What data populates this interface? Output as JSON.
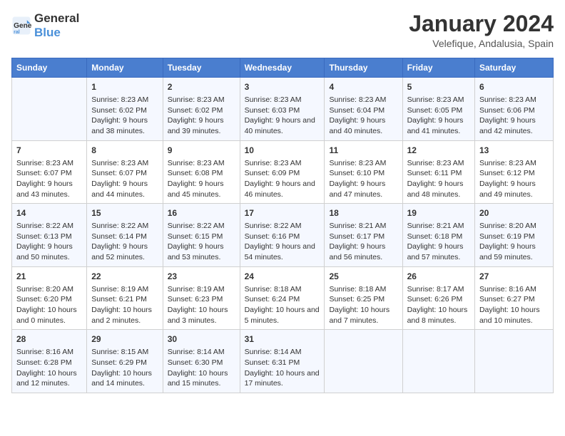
{
  "logo": {
    "text_general": "General",
    "text_blue": "Blue"
  },
  "title": "January 2024",
  "subtitle": "Velefique, Andalusia, Spain",
  "days_header": [
    "Sunday",
    "Monday",
    "Tuesday",
    "Wednesday",
    "Thursday",
    "Friday",
    "Saturday"
  ],
  "weeks": [
    [
      {
        "day": "",
        "sunrise": "",
        "sunset": "",
        "daylight": ""
      },
      {
        "day": "1",
        "sunrise": "Sunrise: 8:23 AM",
        "sunset": "Sunset: 6:02 PM",
        "daylight": "Daylight: 9 hours and 38 minutes."
      },
      {
        "day": "2",
        "sunrise": "Sunrise: 8:23 AM",
        "sunset": "Sunset: 6:02 PM",
        "daylight": "Daylight: 9 hours and 39 minutes."
      },
      {
        "day": "3",
        "sunrise": "Sunrise: 8:23 AM",
        "sunset": "Sunset: 6:03 PM",
        "daylight": "Daylight: 9 hours and 40 minutes."
      },
      {
        "day": "4",
        "sunrise": "Sunrise: 8:23 AM",
        "sunset": "Sunset: 6:04 PM",
        "daylight": "Daylight: 9 hours and 40 minutes."
      },
      {
        "day": "5",
        "sunrise": "Sunrise: 8:23 AM",
        "sunset": "Sunset: 6:05 PM",
        "daylight": "Daylight: 9 hours and 41 minutes."
      },
      {
        "day": "6",
        "sunrise": "Sunrise: 8:23 AM",
        "sunset": "Sunset: 6:06 PM",
        "daylight": "Daylight: 9 hours and 42 minutes."
      }
    ],
    [
      {
        "day": "7",
        "sunrise": "Sunrise: 8:23 AM",
        "sunset": "Sunset: 6:07 PM",
        "daylight": "Daylight: 9 hours and 43 minutes."
      },
      {
        "day": "8",
        "sunrise": "Sunrise: 8:23 AM",
        "sunset": "Sunset: 6:07 PM",
        "daylight": "Daylight: 9 hours and 44 minutes."
      },
      {
        "day": "9",
        "sunrise": "Sunrise: 8:23 AM",
        "sunset": "Sunset: 6:08 PM",
        "daylight": "Daylight: 9 hours and 45 minutes."
      },
      {
        "day": "10",
        "sunrise": "Sunrise: 8:23 AM",
        "sunset": "Sunset: 6:09 PM",
        "daylight": "Daylight: 9 hours and 46 minutes."
      },
      {
        "day": "11",
        "sunrise": "Sunrise: 8:23 AM",
        "sunset": "Sunset: 6:10 PM",
        "daylight": "Daylight: 9 hours and 47 minutes."
      },
      {
        "day": "12",
        "sunrise": "Sunrise: 8:23 AM",
        "sunset": "Sunset: 6:11 PM",
        "daylight": "Daylight: 9 hours and 48 minutes."
      },
      {
        "day": "13",
        "sunrise": "Sunrise: 8:23 AM",
        "sunset": "Sunset: 6:12 PM",
        "daylight": "Daylight: 9 hours and 49 minutes."
      }
    ],
    [
      {
        "day": "14",
        "sunrise": "Sunrise: 8:22 AM",
        "sunset": "Sunset: 6:13 PM",
        "daylight": "Daylight: 9 hours and 50 minutes."
      },
      {
        "day": "15",
        "sunrise": "Sunrise: 8:22 AM",
        "sunset": "Sunset: 6:14 PM",
        "daylight": "Daylight: 9 hours and 52 minutes."
      },
      {
        "day": "16",
        "sunrise": "Sunrise: 8:22 AM",
        "sunset": "Sunset: 6:15 PM",
        "daylight": "Daylight: 9 hours and 53 minutes."
      },
      {
        "day": "17",
        "sunrise": "Sunrise: 8:22 AM",
        "sunset": "Sunset: 6:16 PM",
        "daylight": "Daylight: 9 hours and 54 minutes."
      },
      {
        "day": "18",
        "sunrise": "Sunrise: 8:21 AM",
        "sunset": "Sunset: 6:17 PM",
        "daylight": "Daylight: 9 hours and 56 minutes."
      },
      {
        "day": "19",
        "sunrise": "Sunrise: 8:21 AM",
        "sunset": "Sunset: 6:18 PM",
        "daylight": "Daylight: 9 hours and 57 minutes."
      },
      {
        "day": "20",
        "sunrise": "Sunrise: 8:20 AM",
        "sunset": "Sunset: 6:19 PM",
        "daylight": "Daylight: 9 hours and 59 minutes."
      }
    ],
    [
      {
        "day": "21",
        "sunrise": "Sunrise: 8:20 AM",
        "sunset": "Sunset: 6:20 PM",
        "daylight": "Daylight: 10 hours and 0 minutes."
      },
      {
        "day": "22",
        "sunrise": "Sunrise: 8:19 AM",
        "sunset": "Sunset: 6:21 PM",
        "daylight": "Daylight: 10 hours and 2 minutes."
      },
      {
        "day": "23",
        "sunrise": "Sunrise: 8:19 AM",
        "sunset": "Sunset: 6:23 PM",
        "daylight": "Daylight: 10 hours and 3 minutes."
      },
      {
        "day": "24",
        "sunrise": "Sunrise: 8:18 AM",
        "sunset": "Sunset: 6:24 PM",
        "daylight": "Daylight: 10 hours and 5 minutes."
      },
      {
        "day": "25",
        "sunrise": "Sunrise: 8:18 AM",
        "sunset": "Sunset: 6:25 PM",
        "daylight": "Daylight: 10 hours and 7 minutes."
      },
      {
        "day": "26",
        "sunrise": "Sunrise: 8:17 AM",
        "sunset": "Sunset: 6:26 PM",
        "daylight": "Daylight: 10 hours and 8 minutes."
      },
      {
        "day": "27",
        "sunrise": "Sunrise: 8:16 AM",
        "sunset": "Sunset: 6:27 PM",
        "daylight": "Daylight: 10 hours and 10 minutes."
      }
    ],
    [
      {
        "day": "28",
        "sunrise": "Sunrise: 8:16 AM",
        "sunset": "Sunset: 6:28 PM",
        "daylight": "Daylight: 10 hours and 12 minutes."
      },
      {
        "day": "29",
        "sunrise": "Sunrise: 8:15 AM",
        "sunset": "Sunset: 6:29 PM",
        "daylight": "Daylight: 10 hours and 14 minutes."
      },
      {
        "day": "30",
        "sunrise": "Sunrise: 8:14 AM",
        "sunset": "Sunset: 6:30 PM",
        "daylight": "Daylight: 10 hours and 15 minutes."
      },
      {
        "day": "31",
        "sunrise": "Sunrise: 8:14 AM",
        "sunset": "Sunset: 6:31 PM",
        "daylight": "Daylight: 10 hours and 17 minutes."
      },
      {
        "day": "",
        "sunrise": "",
        "sunset": "",
        "daylight": ""
      },
      {
        "day": "",
        "sunrise": "",
        "sunset": "",
        "daylight": ""
      },
      {
        "day": "",
        "sunrise": "",
        "sunset": "",
        "daylight": ""
      }
    ]
  ]
}
